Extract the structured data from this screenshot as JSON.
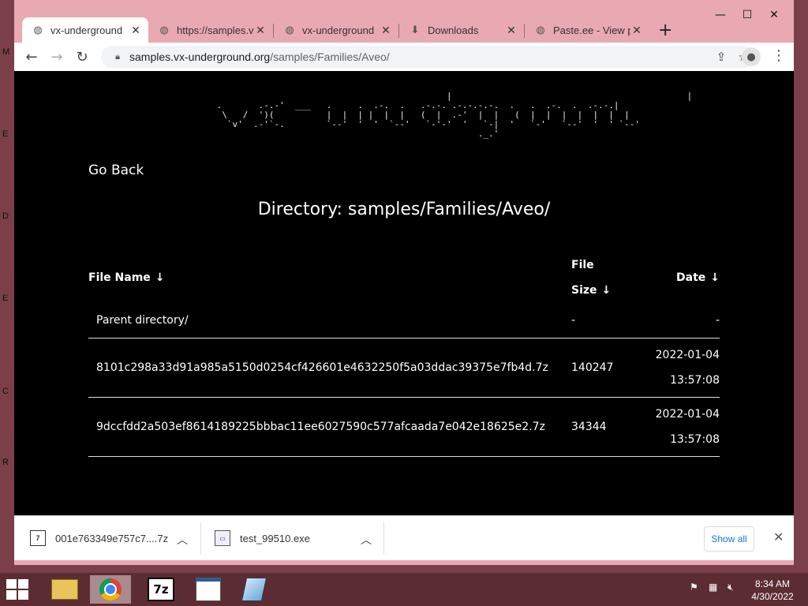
{
  "browser": {
    "tabs": [
      {
        "label": "vx-underground",
        "active": true
      },
      {
        "label": "https://samples.vx"
      },
      {
        "label": "vx-underground"
      },
      {
        "label": "Downloads"
      },
      {
        "label": "Paste.ee - View pa"
      }
    ],
    "url_host": "samples.vx-underground.org",
    "url_path": "/samples/Families/Aveo/"
  },
  "page": {
    "go_back": "Go Back",
    "directory_title": "Directory: samples/Families/Aveo/",
    "columns": {
      "name": "File Name",
      "size_line1": "File",
      "size_line2": "Size",
      "date": "Date",
      "sort_arrow": "↓"
    },
    "rows": [
      {
        "name": "Parent directory/",
        "size": "-",
        "date_line1": "-",
        "date_line2": ""
      },
      {
        "name": "8101c298a33d91a985a5150d0254cf426601e4632250f5a03ddac39375e7fb4d.7z",
        "size": "140247",
        "date_line1": "2022-01-04",
        "date_line2": "13:57:08"
      },
      {
        "name": "9dccfdd2a503ef8614189225bbbac11ee6027590c577afcaada7e042e18625e2.7z",
        "size": "34344",
        "date_line1": "2022-01-04",
        "date_line2": "13:57:08"
      }
    ]
  },
  "downloads": {
    "items": [
      {
        "name": "001e763349e757c7....7z",
        "icon": "7z-archive-icon"
      },
      {
        "name": "test_99510.exe",
        "icon": "exe-file-icon"
      }
    ],
    "show_all": "Show all"
  },
  "taskbar": {
    "time": "8:34 AM",
    "date": "4/30/2022",
    "apps": [
      "file-explorer",
      "chrome",
      "7-zip",
      "document-viewer",
      "notepad"
    ]
  },
  "desktop_letters": [
    "M",
    "E",
    "D",
    "E",
    "C",
    "R"
  ],
  "colors": {
    "titlebar": "#e8a9b2",
    "taskbar": "#5c2c33",
    "content_bg": "#000000",
    "link_blue": "#1a73e8"
  }
}
